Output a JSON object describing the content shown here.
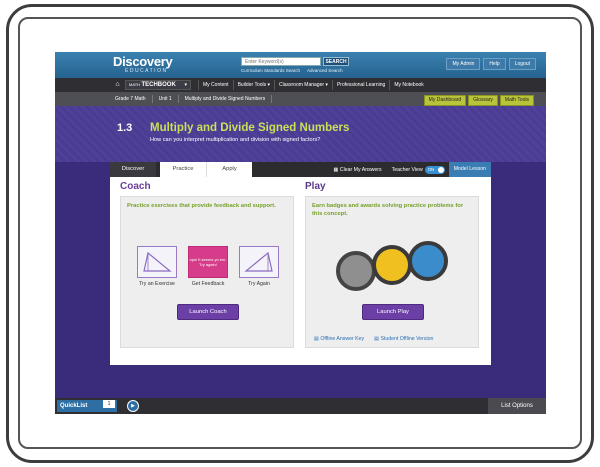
{
  "header": {
    "logo": "Discovery",
    "logo_sub": "EDUCATION",
    "search_placeholder": "Enter Keyword(s)",
    "search_button": "SEARCH",
    "search_links": [
      "Curriculum Standards Search",
      "Advanced Search"
    ],
    "top_links": [
      "My Admin",
      "Help",
      "Logout"
    ]
  },
  "nav": {
    "product_prefix": "MATH",
    "product": "TECHBOOK",
    "items": [
      "My Content",
      "Builder Tools ▾",
      "Classroom Manager ▾",
      "Professional Learning",
      "My Notebook"
    ]
  },
  "breadcrumb": {
    "items": [
      "Grade 7 Math",
      "Unit 1",
      "Multiply and Divide Signed Numbers"
    ],
    "buttons": [
      "My Dashboard",
      "Glossary",
      "Math Tools"
    ]
  },
  "lesson": {
    "number": "1.3",
    "title": "Multiply and Divide Signed Numbers",
    "question": "How can you interpret multiplication and division with signed factors?"
  },
  "tabs": {
    "discover": "Discover",
    "practice": "Practice",
    "apply": "Apply",
    "clear": "Clear My Answers",
    "teacher_view": "Teacher View",
    "toggle_state": "ON",
    "model_lesson": "Model Lesson"
  },
  "coach": {
    "title": "Coach",
    "description": "Practice exercises that provide feedback and support.",
    "steps": [
      "Try an Exercise",
      "Get Feedback",
      "Try Again"
    ],
    "feedback_text": "ops! It seems yo em. Try again!",
    "launch": "Launch Coach"
  },
  "play": {
    "title": "Play",
    "description": "Earn badges and awards solving practice problems for this concept.",
    "launch": "Launch Play",
    "offline_links": [
      "Offline Answer Key",
      "Student Offline Version"
    ]
  },
  "bottom": {
    "quicklist": "QuickList",
    "count": "1",
    "list_options": "List Options"
  },
  "colors": {
    "accent_purple": "#6b3fa6",
    "lesson_title": "#c8e05a",
    "green_text": "#77a02a"
  }
}
